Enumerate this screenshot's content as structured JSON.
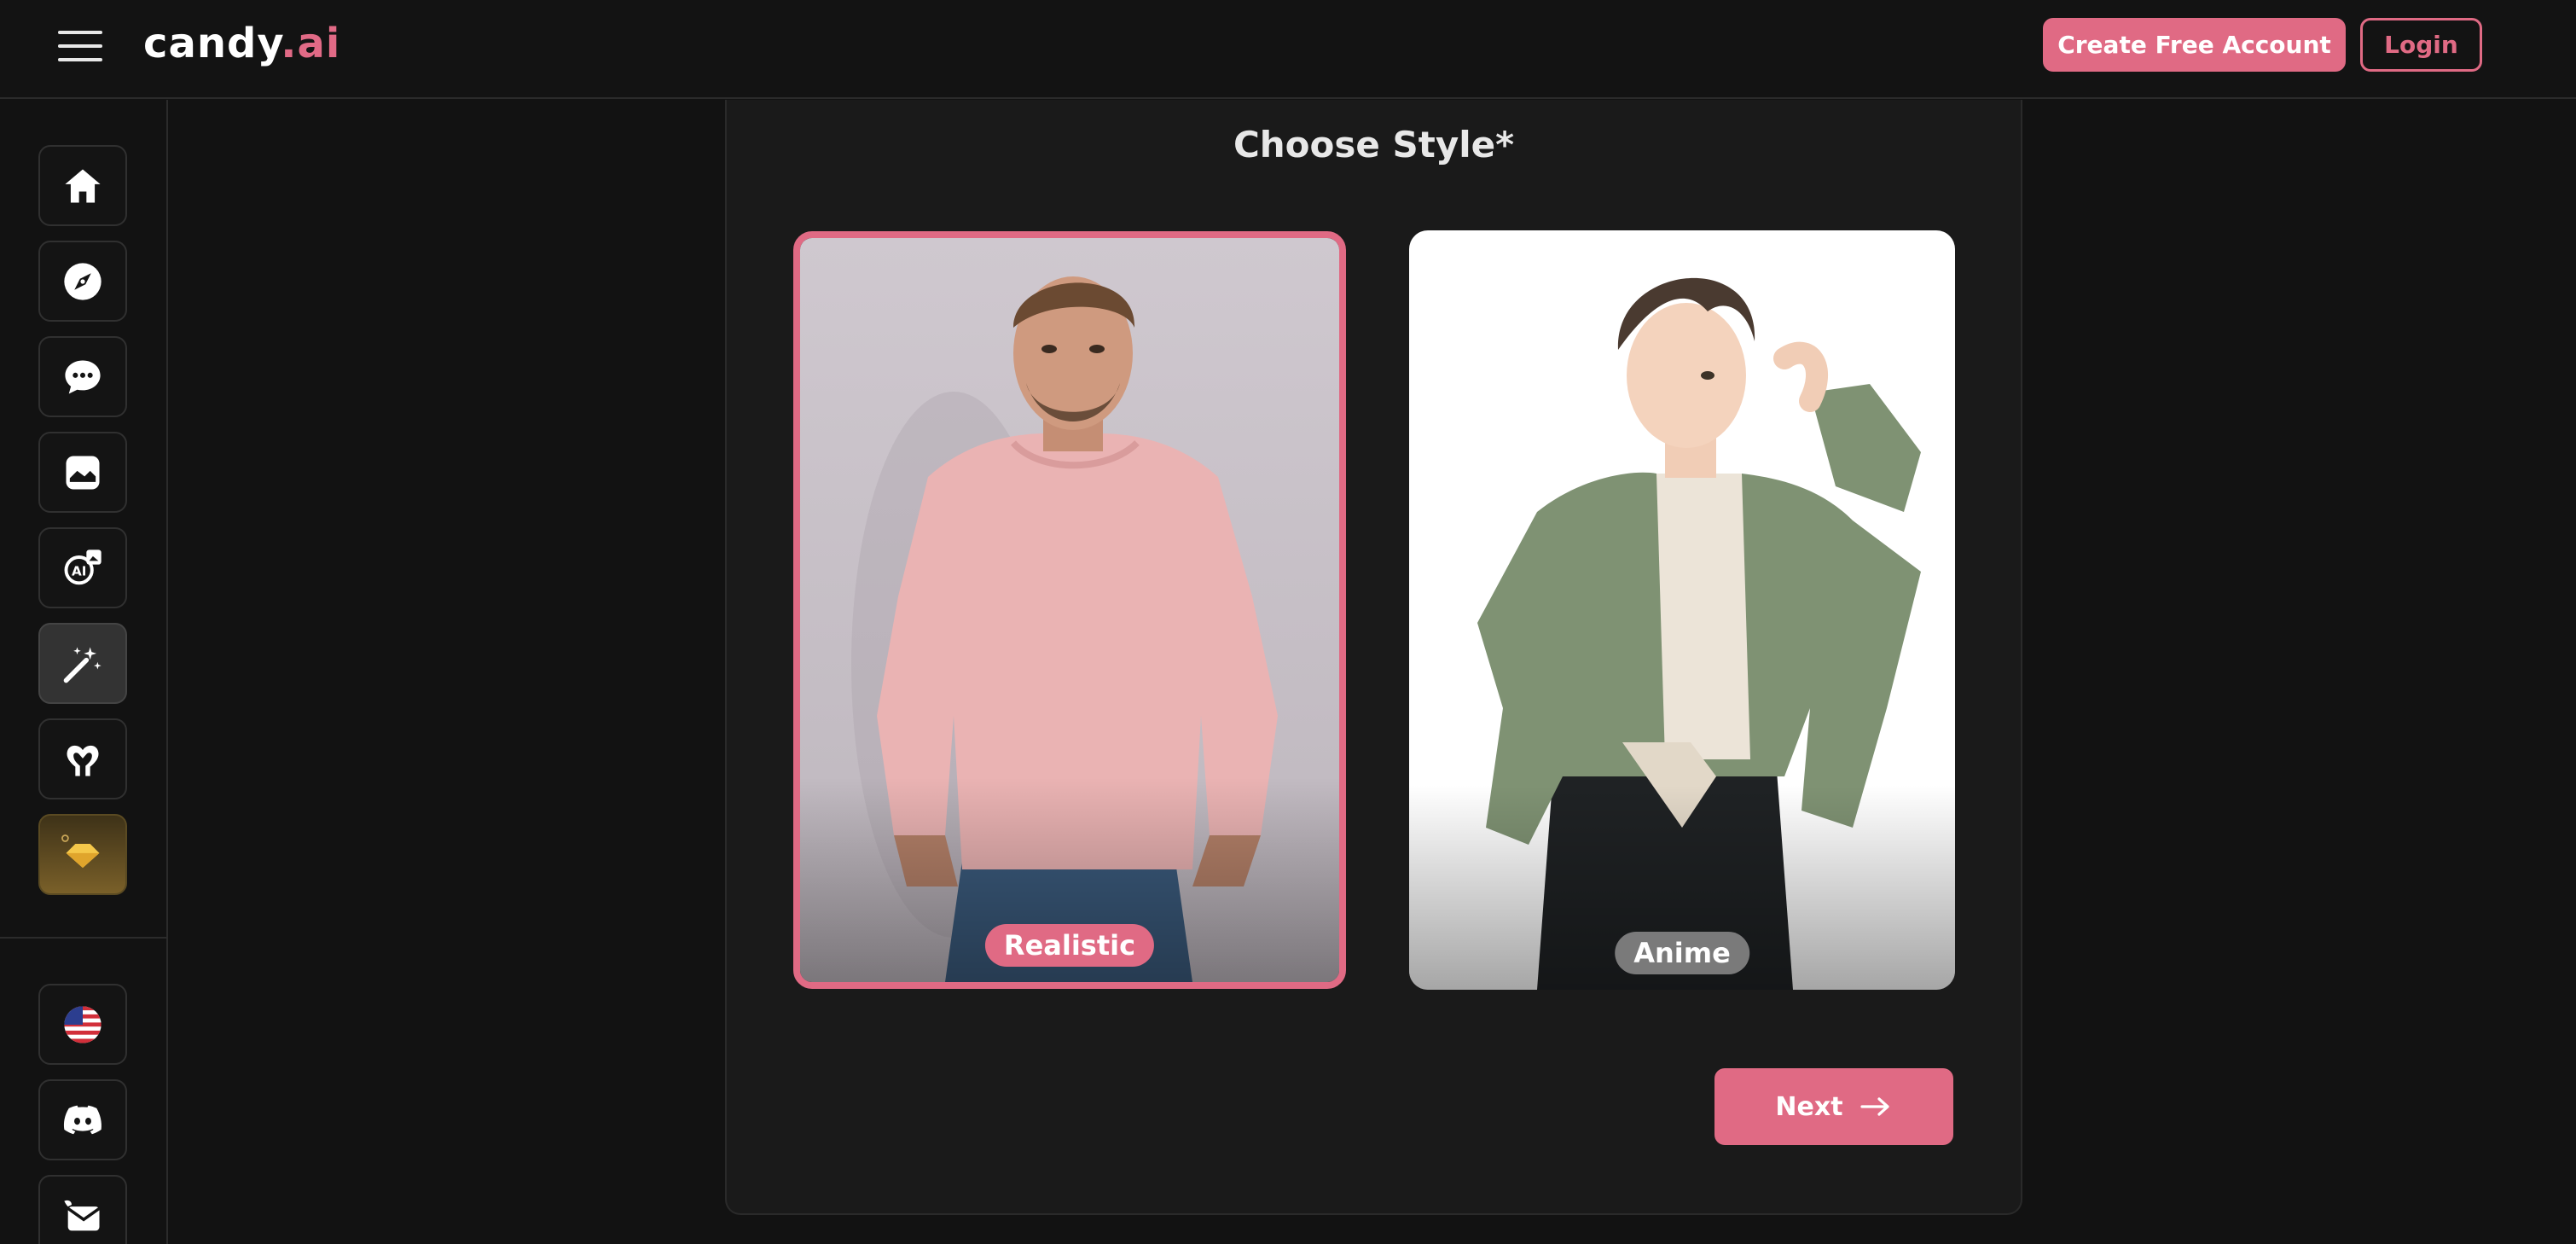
{
  "header": {
    "logo_main": "candy",
    "logo_accent": ".ai",
    "create_account_label": "Create Free Account",
    "login_label": "Login"
  },
  "sidebar": {
    "items": [
      {
        "icon": "home-icon"
      },
      {
        "icon": "compass-icon"
      },
      {
        "icon": "chat-icon"
      },
      {
        "icon": "gallery-icon"
      },
      {
        "icon": "ai-generator-icon"
      },
      {
        "icon": "magic-wand-icon",
        "active": true
      },
      {
        "icon": "heart-hands-icon"
      },
      {
        "icon": "premium-diamond-icon"
      }
    ],
    "bottom_items": [
      {
        "icon": "us-flag-icon"
      },
      {
        "icon": "discord-icon"
      },
      {
        "icon": "contact-icon"
      }
    ]
  },
  "main": {
    "title": "Choose Style*",
    "styles": [
      {
        "label": "Realistic",
        "selected": true
      },
      {
        "label": "Anime",
        "selected": false
      }
    ],
    "next_label": "Next"
  },
  "colors": {
    "accent": "#e06a84",
    "background": "#121212",
    "panel": "#1a1a1a"
  }
}
